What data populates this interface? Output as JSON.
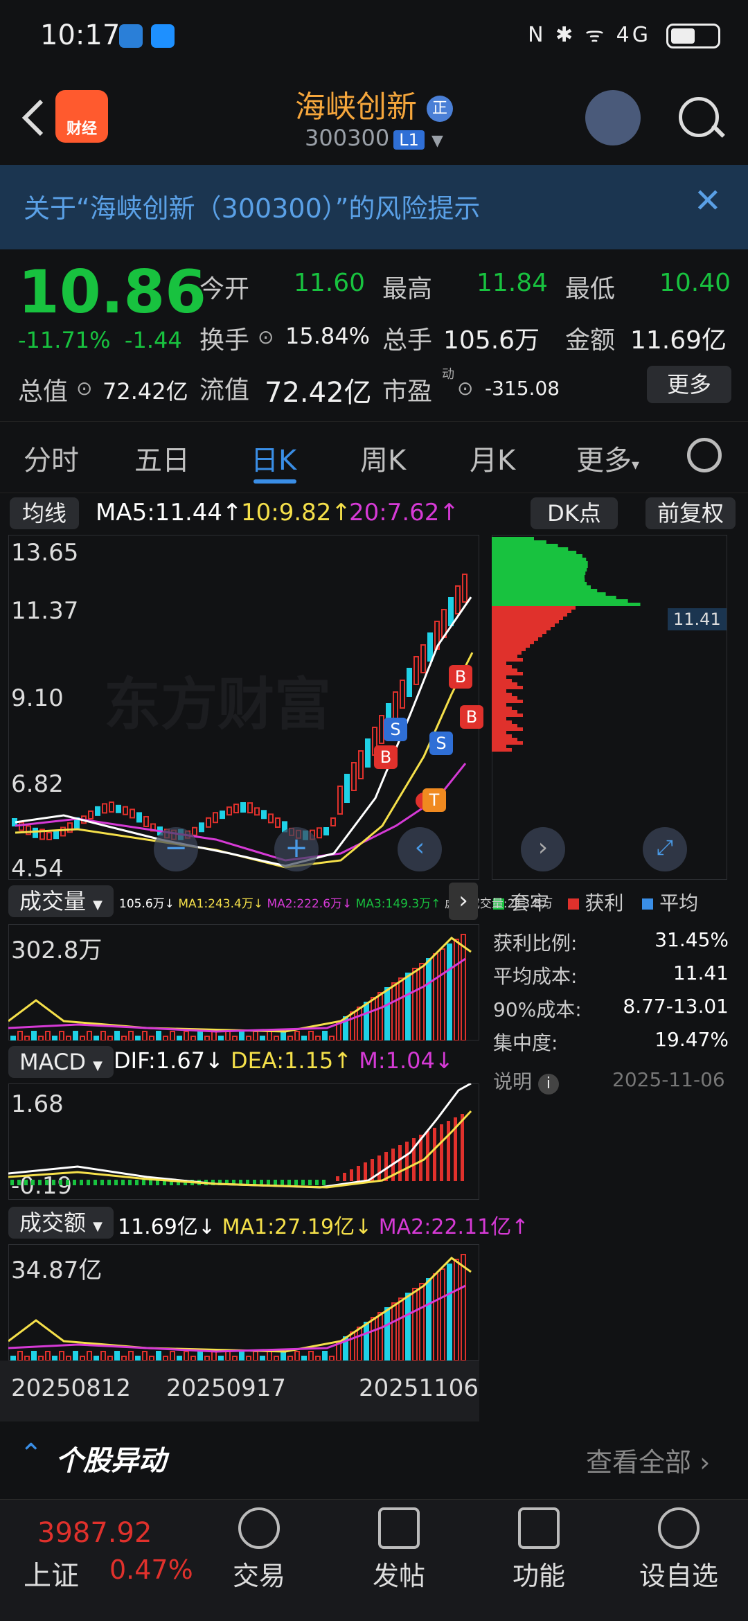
{
  "status": {
    "time": "10:17",
    "right": "N ✱ ᯤ 4G"
  },
  "header": {
    "logo": "财经",
    "title": "海峡创新",
    "title_badge": "正",
    "code": "300300",
    "level": "L1"
  },
  "risk": {
    "text": "关于“海峡创新（300300）”的风险提示"
  },
  "quote": {
    "price": "10.86",
    "pct": "-11.71%",
    "change": "-1.44",
    "open_label": "今开",
    "open": "11.60",
    "high_label": "最高",
    "high": "11.84",
    "low_label": "最低",
    "low": "10.40",
    "turn_label": "换手",
    "turn": "15.84%",
    "vol_label": "总手",
    "vol": "105.6万",
    "amt_label": "金额",
    "amt": "11.69亿",
    "mcap_label": "总值",
    "mcap": "72.42亿",
    "fcap_label": "流值",
    "fcap": "72.42亿",
    "pe_label": "市盈",
    "pe_sup": "动",
    "pe": "-315.08",
    "more": "更多"
  },
  "tabs": [
    "分时",
    "五日",
    "日K",
    "周K",
    "月K",
    "更多"
  ],
  "ma": {
    "label": "均线",
    "ma5": "MA5:11.44↑",
    "ma10": "10:9.82↑",
    "ma20": "20:7.62↑",
    "dk": "DK点",
    "fq": "前复权"
  },
  "kaxis": [
    "13.65",
    "11.37",
    "9.10",
    "6.82",
    "4.54"
  ],
  "watermark": "东方财富",
  "chip": {
    "tag": "11.41",
    "legend": [
      "套牢",
      "获利",
      "平均"
    ],
    "rows": [
      [
        "获利比例:",
        "31.45%"
      ],
      [
        "平均成本:",
        "11.41"
      ],
      [
        "90%成本:",
        "8.77-13.01"
      ],
      [
        "集中度:",
        "19.47%"
      ]
    ],
    "note": "说明",
    "date": "2025-11-06"
  },
  "vol": {
    "label": "成交量",
    "vals": "105.6万↓",
    "ma1": "MA1:243.4万↓",
    "ma2": "MA2:222.6万↓",
    "ma3": "MA3:149.3万↑",
    "virt": "虚拟成交量:213.8万",
    "top": "302.8万"
  },
  "macd": {
    "label": "MACD",
    "dif": "DIF:1.67↓",
    "dea": "DEA:1.15↑",
    "m": "M:1.04↓",
    "top": "1.68",
    "bottom": "-0.19"
  },
  "amount": {
    "label": "成交额",
    "val": "11.69亿↓",
    "ma1": "MA1:27.19亿↓",
    "ma2": "MA2:22.11亿↑",
    "top": "34.87亿"
  },
  "dates": [
    "20250812",
    "20250917",
    "20251106"
  ],
  "news": {
    "title": "个股异动",
    "all": "查看全部"
  },
  "nav": {
    "index_val": "3987.92",
    "index_name": "上证",
    "index_pct": "0.47%",
    "items": [
      "交易",
      "发帖",
      "功能",
      "设自选"
    ]
  },
  "colors": {
    "up": "#e0312c",
    "down": "#18c23f",
    "accent": "#3a8ee6",
    "ma5": "#ffffff",
    "ma10": "#f5e04a",
    "ma20": "#d63ad6"
  }
}
